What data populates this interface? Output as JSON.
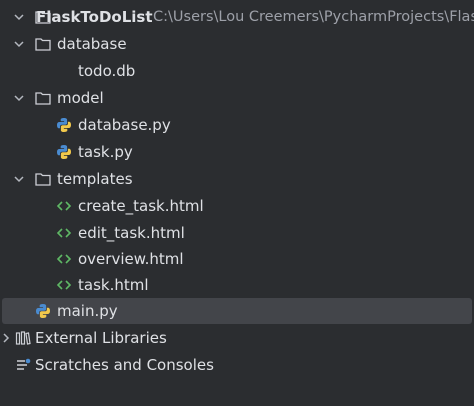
{
  "project_tree": {
    "root": {
      "name": "FlaskToDoList",
      "path": "C:\\Users\\Lou Creemers\\PycharmProjects\\Flask"
    },
    "database_folder": "database",
    "todo_db": "todo.db",
    "model_folder": "model",
    "database_py": "database.py",
    "task_py": "task.py",
    "templates_folder": "templates",
    "create_task_html": "create_task.html",
    "edit_task_html": "edit_task.html",
    "overview_html": "overview.html",
    "task_html": "task.html",
    "main_py": "main.py",
    "external_libraries": "External Libraries",
    "scratches": "Scratches and Consoles"
  },
  "icons": {
    "folder": "folder-icon",
    "python": "python-file-icon",
    "html": "html-file-icon",
    "library": "library-icon",
    "scratches": "scratches-icon"
  },
  "colors": {
    "background": "#2b2d30",
    "selection": "#43454a",
    "text": "#dfe1e5",
    "path_text": "#9da0a8",
    "html_icon": "#5fb865",
    "python_blue": "#4a8bd0",
    "python_yellow": "#f2c94c"
  }
}
